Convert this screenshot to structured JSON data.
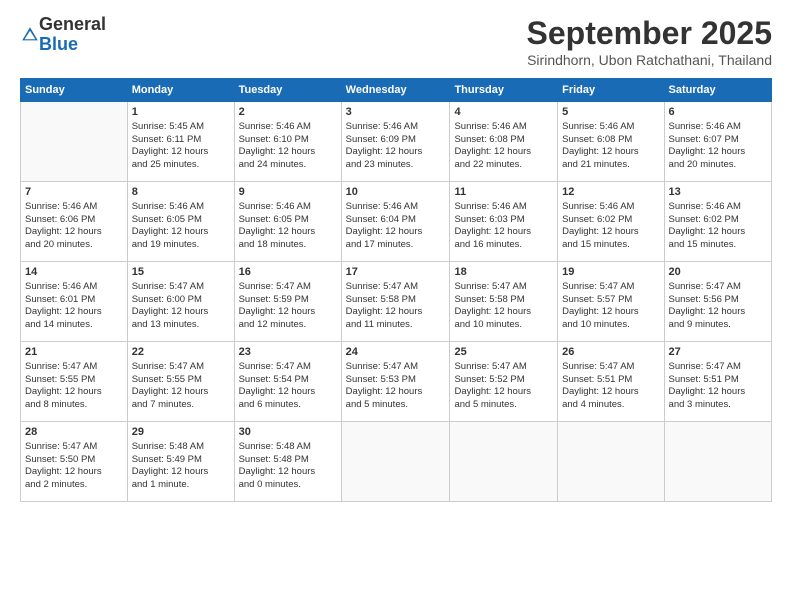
{
  "header": {
    "logo": {
      "line1": "General",
      "line2": "Blue"
    },
    "title": "September 2025",
    "location": "Sirindhorn, Ubon Ratchathani, Thailand"
  },
  "weekdays": [
    "Sunday",
    "Monday",
    "Tuesday",
    "Wednesday",
    "Thursday",
    "Friday",
    "Saturday"
  ],
  "weeks": [
    [
      {
        "day": "",
        "sunrise": "",
        "sunset": "",
        "daylight": ""
      },
      {
        "day": "1",
        "sunrise": "Sunrise: 5:45 AM",
        "sunset": "Sunset: 6:11 PM",
        "daylight": "Daylight: 12 hours and 25 minutes."
      },
      {
        "day": "2",
        "sunrise": "Sunrise: 5:46 AM",
        "sunset": "Sunset: 6:10 PM",
        "daylight": "Daylight: 12 hours and 24 minutes."
      },
      {
        "day": "3",
        "sunrise": "Sunrise: 5:46 AM",
        "sunset": "Sunset: 6:09 PM",
        "daylight": "Daylight: 12 hours and 23 minutes."
      },
      {
        "day": "4",
        "sunrise": "Sunrise: 5:46 AM",
        "sunset": "Sunset: 6:08 PM",
        "daylight": "Daylight: 12 hours and 22 minutes."
      },
      {
        "day": "5",
        "sunrise": "Sunrise: 5:46 AM",
        "sunset": "Sunset: 6:08 PM",
        "daylight": "Daylight: 12 hours and 21 minutes."
      },
      {
        "day": "6",
        "sunrise": "Sunrise: 5:46 AM",
        "sunset": "Sunset: 6:07 PM",
        "daylight": "Daylight: 12 hours and 20 minutes."
      }
    ],
    [
      {
        "day": "7",
        "sunrise": "Sunrise: 5:46 AM",
        "sunset": "Sunset: 6:06 PM",
        "daylight": "Daylight: 12 hours and 20 minutes."
      },
      {
        "day": "8",
        "sunrise": "Sunrise: 5:46 AM",
        "sunset": "Sunset: 6:05 PM",
        "daylight": "Daylight: 12 hours and 19 minutes."
      },
      {
        "day": "9",
        "sunrise": "Sunrise: 5:46 AM",
        "sunset": "Sunset: 6:05 PM",
        "daylight": "Daylight: 12 hours and 18 minutes."
      },
      {
        "day": "10",
        "sunrise": "Sunrise: 5:46 AM",
        "sunset": "Sunset: 6:04 PM",
        "daylight": "Daylight: 12 hours and 17 minutes."
      },
      {
        "day": "11",
        "sunrise": "Sunrise: 5:46 AM",
        "sunset": "Sunset: 6:03 PM",
        "daylight": "Daylight: 12 hours and 16 minutes."
      },
      {
        "day": "12",
        "sunrise": "Sunrise: 5:46 AM",
        "sunset": "Sunset: 6:02 PM",
        "daylight": "Daylight: 12 hours and 15 minutes."
      },
      {
        "day": "13",
        "sunrise": "Sunrise: 5:46 AM",
        "sunset": "Sunset: 6:02 PM",
        "daylight": "Daylight: 12 hours and 15 minutes."
      }
    ],
    [
      {
        "day": "14",
        "sunrise": "Sunrise: 5:46 AM",
        "sunset": "Sunset: 6:01 PM",
        "daylight": "Daylight: 12 hours and 14 minutes."
      },
      {
        "day": "15",
        "sunrise": "Sunrise: 5:47 AM",
        "sunset": "Sunset: 6:00 PM",
        "daylight": "Daylight: 12 hours and 13 minutes."
      },
      {
        "day": "16",
        "sunrise": "Sunrise: 5:47 AM",
        "sunset": "Sunset: 5:59 PM",
        "daylight": "Daylight: 12 hours and 12 minutes."
      },
      {
        "day": "17",
        "sunrise": "Sunrise: 5:47 AM",
        "sunset": "Sunset: 5:58 PM",
        "daylight": "Daylight: 12 hours and 11 minutes."
      },
      {
        "day": "18",
        "sunrise": "Sunrise: 5:47 AM",
        "sunset": "Sunset: 5:58 PM",
        "daylight": "Daylight: 12 hours and 10 minutes."
      },
      {
        "day": "19",
        "sunrise": "Sunrise: 5:47 AM",
        "sunset": "Sunset: 5:57 PM",
        "daylight": "Daylight: 12 hours and 10 minutes."
      },
      {
        "day": "20",
        "sunrise": "Sunrise: 5:47 AM",
        "sunset": "Sunset: 5:56 PM",
        "daylight": "Daylight: 12 hours and 9 minutes."
      }
    ],
    [
      {
        "day": "21",
        "sunrise": "Sunrise: 5:47 AM",
        "sunset": "Sunset: 5:55 PM",
        "daylight": "Daylight: 12 hours and 8 minutes."
      },
      {
        "day": "22",
        "sunrise": "Sunrise: 5:47 AM",
        "sunset": "Sunset: 5:55 PM",
        "daylight": "Daylight: 12 hours and 7 minutes."
      },
      {
        "day": "23",
        "sunrise": "Sunrise: 5:47 AM",
        "sunset": "Sunset: 5:54 PM",
        "daylight": "Daylight: 12 hours and 6 minutes."
      },
      {
        "day": "24",
        "sunrise": "Sunrise: 5:47 AM",
        "sunset": "Sunset: 5:53 PM",
        "daylight": "Daylight: 12 hours and 5 minutes."
      },
      {
        "day": "25",
        "sunrise": "Sunrise: 5:47 AM",
        "sunset": "Sunset: 5:52 PM",
        "daylight": "Daylight: 12 hours and 5 minutes."
      },
      {
        "day": "26",
        "sunrise": "Sunrise: 5:47 AM",
        "sunset": "Sunset: 5:51 PM",
        "daylight": "Daylight: 12 hours and 4 minutes."
      },
      {
        "day": "27",
        "sunrise": "Sunrise: 5:47 AM",
        "sunset": "Sunset: 5:51 PM",
        "daylight": "Daylight: 12 hours and 3 minutes."
      }
    ],
    [
      {
        "day": "28",
        "sunrise": "Sunrise: 5:47 AM",
        "sunset": "Sunset: 5:50 PM",
        "daylight": "Daylight: 12 hours and 2 minutes."
      },
      {
        "day": "29",
        "sunrise": "Sunrise: 5:48 AM",
        "sunset": "Sunset: 5:49 PM",
        "daylight": "Daylight: 12 hours and 1 minute."
      },
      {
        "day": "30",
        "sunrise": "Sunrise: 5:48 AM",
        "sunset": "Sunset: 5:48 PM",
        "daylight": "Daylight: 12 hours and 0 minutes."
      },
      {
        "day": "",
        "sunrise": "",
        "sunset": "",
        "daylight": ""
      },
      {
        "day": "",
        "sunrise": "",
        "sunset": "",
        "daylight": ""
      },
      {
        "day": "",
        "sunrise": "",
        "sunset": "",
        "daylight": ""
      },
      {
        "day": "",
        "sunrise": "",
        "sunset": "",
        "daylight": ""
      }
    ]
  ]
}
